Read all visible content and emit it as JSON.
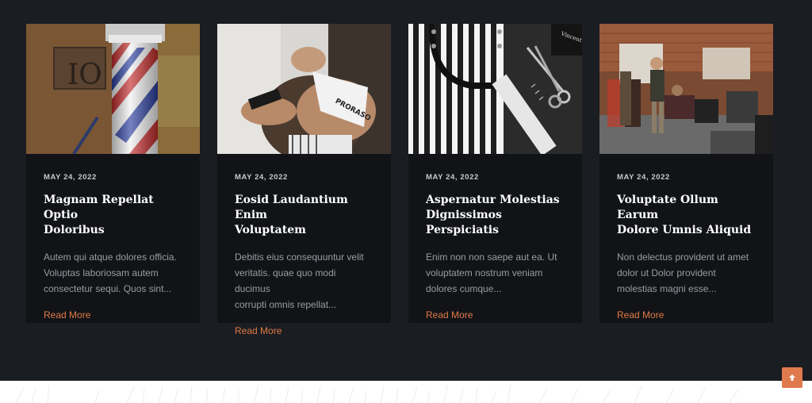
{
  "posts": [
    {
      "date": "MAY 24, 2022",
      "title_line1": "Magnam Repellat Optio",
      "title_line2": "Doloribus",
      "excerpt_line1": "Autem qui atque dolores officia.",
      "excerpt_line2": "Voluptas laboriosam autem",
      "excerpt_line3": "consectetur sequi. Quos sint...",
      "read_more": "Read More",
      "image_text": "IO"
    },
    {
      "date": "MAY 24, 2022",
      "title_line1": "Eosid Laudantium Enim",
      "title_line2": "Voluptatem",
      "excerpt_line1": "Debitis eius consequuntur velit",
      "excerpt_line2": "veritatis. quae quo modi ducimus",
      "excerpt_line3": "corrupti omnis repellat...",
      "read_more": "Read More",
      "image_text": "PRORASO"
    },
    {
      "date": "MAY 24, 2022",
      "title_line1": "Aspernatur Molestias",
      "title_line2": "Dignissimos Perspiciatis",
      "excerpt_line1": "Enim non non saepe aut ea. Ut",
      "excerpt_line2": "voluptatem nostrum veniam",
      "excerpt_line3": "dolores cumque...",
      "read_more": "Read More",
      "image_text": "Vincent"
    },
    {
      "date": "MAY 24, 2022",
      "title_line1": "Voluptate Ollum Earum",
      "title_line2": "Dolore Umnis Aliquid",
      "excerpt_line1": "Non delectus provident ut amet",
      "excerpt_line2": "dolor ut Dolor provident",
      "excerpt_line3": "molestias magni esse...",
      "read_more": "Read More",
      "image_text": ""
    }
  ],
  "colors": {
    "background": "#1a1d22",
    "card": "#111317",
    "accent": "#e27b45",
    "title": "#ffffff",
    "text": "#9a9ca2"
  },
  "icons": {
    "scroll_top": "arrow-up-icon"
  }
}
